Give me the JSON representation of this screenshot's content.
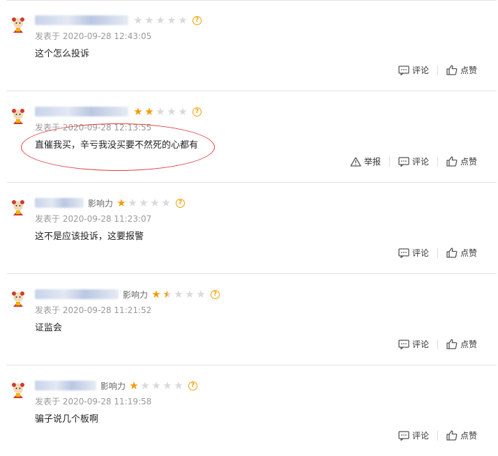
{
  "labels": {
    "published_prefix": "发表于",
    "influence": "影响力",
    "comment": "评论",
    "like": "点赞",
    "report": "举报"
  },
  "colors": {
    "star_on": "#f59a00",
    "star_off": "#d9d9d9",
    "annotation": "#e23a3a"
  },
  "icons": [
    "avatar-icon",
    "star-icon",
    "help-icon",
    "comment-icon",
    "like-icon",
    "report-icon"
  ],
  "comments": [
    {
      "time": "2020-09-28 12:43:05",
      "text": "这个怎么投诉",
      "influence_label_visible": false,
      "rating": 0,
      "show_report": false
    },
    {
      "time": "2020-09-28 12:13:55",
      "text": "直催我买，辛亏我没买要不然死的心都有",
      "influence_label_visible": false,
      "rating": 2,
      "show_report": true
    },
    {
      "time": "2020-09-28 11:23:07",
      "text": "这不是应该投诉，这要报警",
      "influence_label_visible": true,
      "rating": 1,
      "show_report": false
    },
    {
      "time": "2020-09-28 11:21:52",
      "text": "证监会",
      "influence_label_visible": true,
      "rating": 1.5,
      "show_report": false
    },
    {
      "time": "2020-09-28 11:19:58",
      "text": "骗子说几个板啊",
      "influence_label_visible": true,
      "rating": 1,
      "show_report": false
    }
  ]
}
